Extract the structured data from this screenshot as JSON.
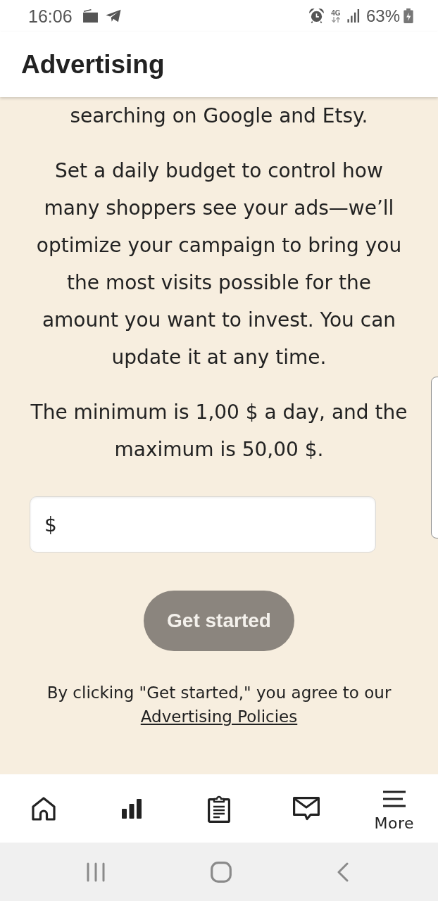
{
  "status_bar": {
    "time": "16:06",
    "network": "4G",
    "battery": "63%"
  },
  "header": {
    "title": "Advertising"
  },
  "content": {
    "paragraphs": [
      "searching on Google and Etsy.",
      "Set a daily budget to control how many shoppers see your ads—we’ll optimize your campaign to bring you the most visits possible for the amount you want to invest. You can update it at any time.",
      "The minimum is 1,00 $ a day, and the maximum is 50,00 $."
    ],
    "budget_field": {
      "prefix": "$"
    },
    "submit_button": {
      "label": "Get started",
      "disabled": true
    },
    "legal": {
      "text": "By clicking \"Get started,\" you agree to our",
      "link": "Advertising Policies"
    }
  },
  "bottom_nav": [
    {
      "kind": "home"
    },
    {
      "kind": "stats"
    },
    {
      "kind": "orders"
    },
    {
      "kind": "messages"
    },
    {
      "kind": "more",
      "label": "More"
    }
  ]
}
